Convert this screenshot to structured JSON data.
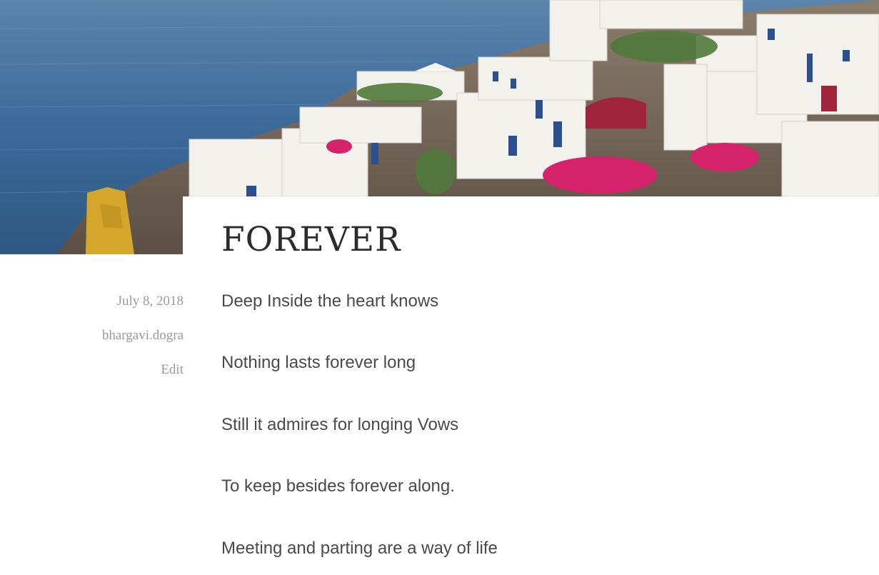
{
  "post": {
    "title": "FOREVER",
    "meta": {
      "date": "July 8, 2018",
      "author": "bhargavi.dogra",
      "edit_label": "Edit"
    },
    "lines": [
      "Deep Inside the heart knows",
      "Nothing lasts forever long",
      "Still it admires for longing Vows",
      "To keep besides forever along.",
      "Meeting and parting are a way of life"
    ]
  },
  "colors": {
    "title": "#2b2b2b",
    "meta": "#9a9a9a",
    "body_text": "#4a4a4a",
    "sea": "#3f6f9f"
  }
}
